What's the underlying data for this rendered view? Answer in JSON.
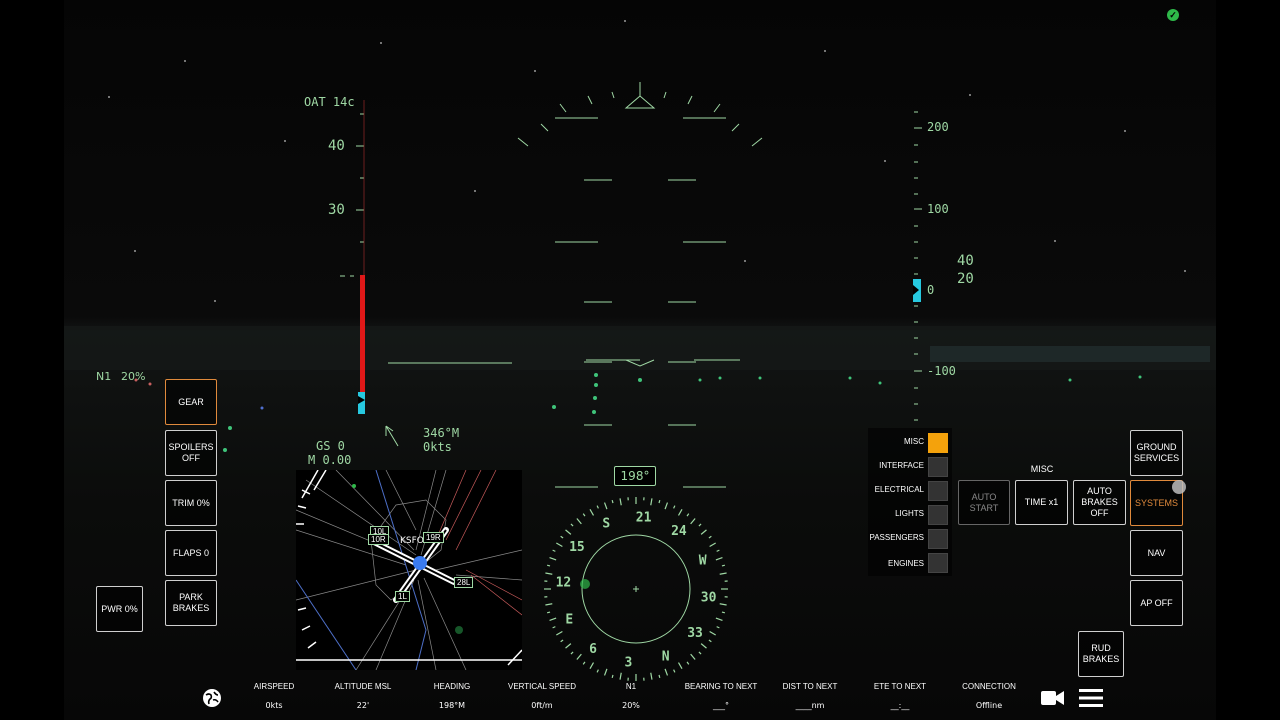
{
  "hud": {
    "oat": "OAT 14c",
    "speed_ticks": [
      "40",
      "30"
    ],
    "altitude_ticks": [
      "200",
      "100",
      "0",
      "-100"
    ],
    "vs_ticks": [
      "40",
      "20"
    ],
    "n1_label": "N1",
    "n1_value": "20%",
    "gs": "GS 0",
    "mach": "M 0.00",
    "wind_dir": "346°M",
    "wind_speed": "0kts",
    "heading_readout": "198°"
  },
  "compass": {
    "labels": [
      "S",
      "21",
      "24",
      "W",
      "30",
      "33",
      "N",
      "3",
      "6",
      "E",
      "12",
      "15"
    ]
  },
  "map": {
    "airport": "KSFO",
    "runways": [
      "10L",
      "10R",
      "19R",
      "28L",
      "1L"
    ]
  },
  "left_buttons": {
    "gear": "GEAR",
    "spoilers": "SPOILERS OFF",
    "trim": "TRIM 0%",
    "flaps": "FLAPS 0",
    "park_brakes": "PARK BRAKES",
    "pwr": "PWR 0%"
  },
  "systems_list": [
    "MISC",
    "INTERFACE",
    "ELECTRICAL",
    "LIGHTS",
    "PASSENGERS",
    "ENGINES"
  ],
  "misc_panel": {
    "title": "MISC",
    "auto_start": "AUTO START",
    "time": "TIME x1",
    "auto_brakes": "AUTO BRAKES OFF"
  },
  "right_buttons": {
    "ground_services": "GROUND SERVICES",
    "systems": "SYSTEMS",
    "nav": "NAV",
    "ap": "AP OFF",
    "rud_brakes": "RUD BRAKES"
  },
  "bottom_bar": [
    {
      "label": "AIRSPEED",
      "value": "0kts"
    },
    {
      "label": "ALTITUDE MSL",
      "value": "22'"
    },
    {
      "label": "HEADING",
      "value": "198°M"
    },
    {
      "label": "VERTICAL SPEED",
      "value": "0ft/m"
    },
    {
      "label": "N1",
      "value": "20%"
    },
    {
      "label": "BEARING TO NEXT",
      "value": "___°"
    },
    {
      "label": "DIST TO NEXT",
      "value": "____nm"
    },
    {
      "label": "ETE TO NEXT",
      "value": "__:__"
    },
    {
      "label": "CONNECTION",
      "value": "Offline"
    }
  ],
  "colors": {
    "hud": "#9fd8a4",
    "accent": "#f4a20c",
    "active_border": "#e08a3c",
    "speed_tape": "#e01818",
    "cyan": "#27c9e0"
  }
}
